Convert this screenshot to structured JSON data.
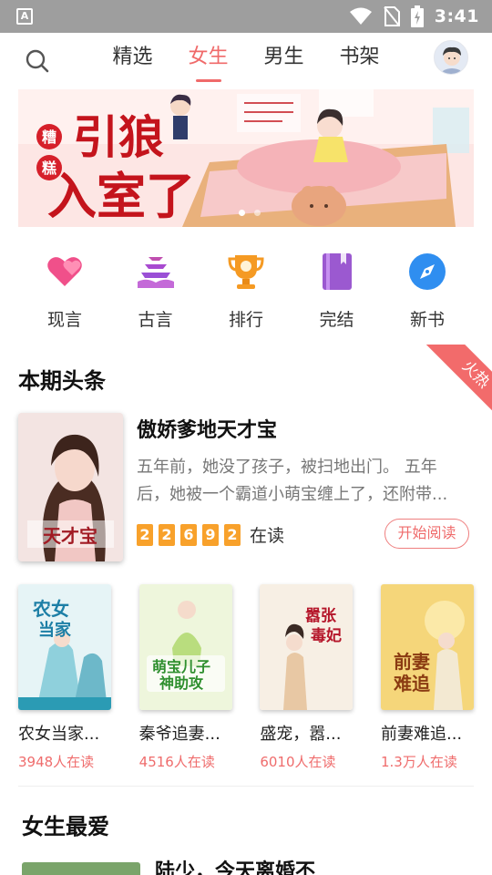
{
  "status_bar": {
    "time": "3:41",
    "notification_icon": "text-a-notification-icon",
    "icons": [
      "wifi-icon",
      "no-sim-icon",
      "battery-charging-icon"
    ]
  },
  "nav": {
    "tabs": [
      {
        "label": "精选",
        "active": false
      },
      {
        "label": "女生",
        "active": true
      },
      {
        "label": "男生",
        "active": false
      },
      {
        "label": "书架",
        "active": false
      }
    ],
    "accent": "#f06a6a"
  },
  "banner": {
    "title_main": "引狼入室了",
    "title_side": "糟糕",
    "page_count": 2,
    "current_page": 1
  },
  "categories": [
    {
      "label": "现言",
      "icon": "hearts-icon",
      "color": "#f0508a"
    },
    {
      "label": "古言",
      "icon": "pagoda-icon",
      "color": "#9a4fd6"
    },
    {
      "label": "排行",
      "icon": "trophy-icon",
      "color": "#f59a23"
    },
    {
      "label": "完结",
      "icon": "book-icon",
      "color": "#9b59d0"
    },
    {
      "label": "新书",
      "icon": "compass-icon",
      "color": "#2f8ef0"
    }
  ],
  "headline": {
    "section_title": "本期头条",
    "badge": "火热",
    "book": {
      "title": "傲娇爹地天才宝",
      "description_line1": "五年前，她没了孩子，被扫地出门。 五年",
      "description_line2": "后，她被一个霸道小萌宝缠上了，还附带...",
      "reader_digits": [
        "2",
        "2",
        "6",
        "9",
        "2"
      ],
      "reading_label": "在读",
      "action_label": "开始阅读"
    }
  },
  "books": [
    {
      "title": "农女当家...",
      "readers": "3948人在读"
    },
    {
      "title": "秦爷追妻...",
      "readers": "4516人在读"
    },
    {
      "title": "盛宠，嚣...",
      "readers": "6010人在读"
    },
    {
      "title": "前妻难追...",
      "readers": "1.3万人在读"
    }
  ],
  "favorites": {
    "section_title": "女生最爱",
    "first_book_title": "陆少，今天离婚不"
  }
}
